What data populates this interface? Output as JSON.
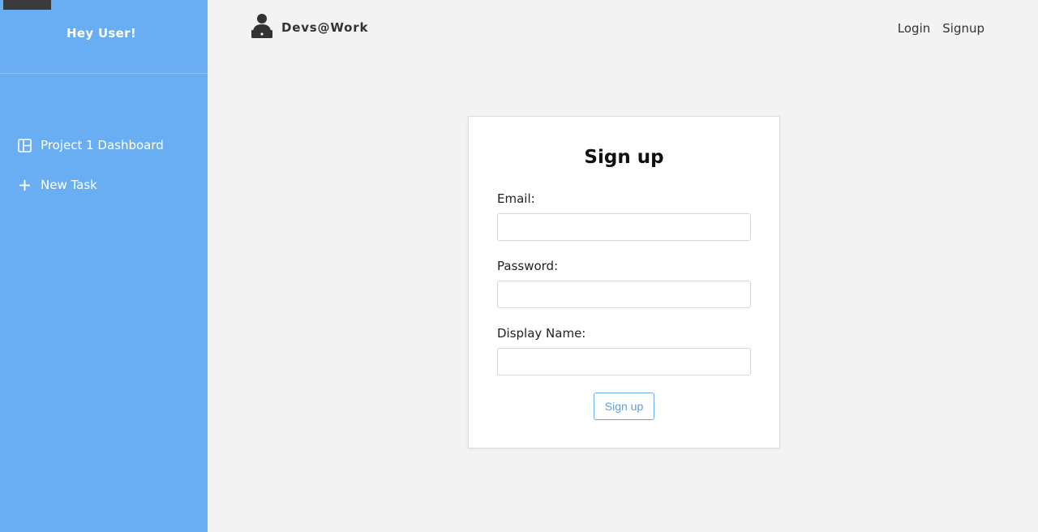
{
  "sidebar": {
    "greeting": "Hey User!",
    "items": [
      {
        "label": "Project 1 Dashboard",
        "icon": "dashboard-layout-icon"
      },
      {
        "label": "New Task",
        "icon": "plus-icon"
      }
    ]
  },
  "header": {
    "brand": "Devs@Work",
    "brand_icon": "developer-laptop-icon",
    "nav": [
      "Login",
      "Signup"
    ]
  },
  "form": {
    "title": "Sign up",
    "fields": [
      {
        "label": "Email:",
        "value": "",
        "placeholder": ""
      },
      {
        "label": "Password:",
        "value": "",
        "placeholder": ""
      },
      {
        "label": "Display Name:",
        "value": "",
        "placeholder": ""
      }
    ],
    "submit_label": "Sign up"
  },
  "colors": {
    "sidebar": "#69aef3",
    "page_background": "#f3f3f3",
    "accent": "#5a9fe6"
  }
}
